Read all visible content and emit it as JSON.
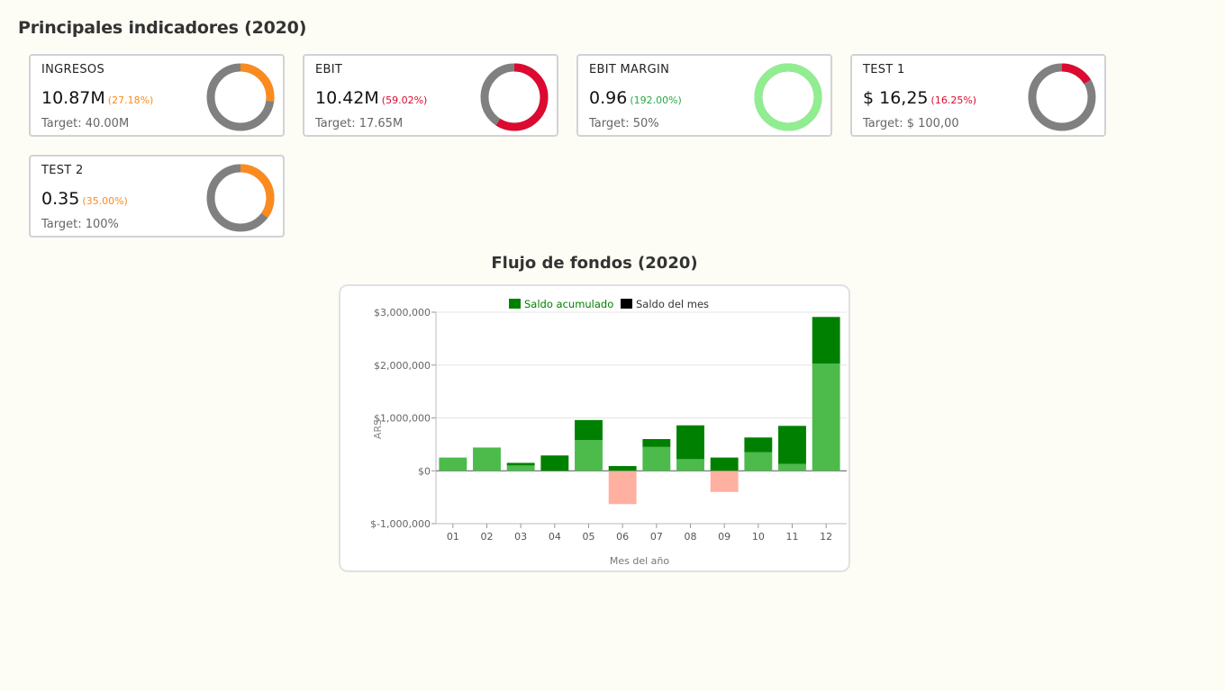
{
  "page": {
    "title": "Principales indicadores (2020)"
  },
  "kpis": [
    {
      "name": "INGRESOS",
      "value": "10.87M",
      "pct": "(27.18%)",
      "target": "Target: 40.00M",
      "fraction": 0.2718,
      "color": "#fb8b1e"
    },
    {
      "name": "EBIT",
      "value": "10.42M",
      "pct": "(59.02%)",
      "target": "Target: 17.65M",
      "fraction": 0.5902,
      "color": "#dc0a30"
    },
    {
      "name": "EBIT MARGIN",
      "value": "0.96",
      "pct": "(192.00%)",
      "target": "Target: 50%",
      "fraction": 1.0,
      "color": "#90ee90",
      "pct_color": "#2aa84a"
    },
    {
      "name": "TEST 1",
      "value": "$ 16,25",
      "pct": "(16.25%)",
      "target": "Target: $ 100,00",
      "fraction": 0.1625,
      "color": "#dc0a30"
    },
    {
      "name": "TEST 2",
      "value": "0.35",
      "pct": "(35.00%)",
      "target": "Target: 100%",
      "fraction": 0.35,
      "color": "#fb8b1e"
    }
  ],
  "colors": {
    "track": "#808080",
    "accumulated": "#4cbb4c",
    "month": "#008000",
    "negative": "#ffb0a0",
    "legend_accumulated": "#008000",
    "legend_month": "#000000"
  },
  "chart_data": {
    "type": "bar",
    "title": "Flujo de fondos (2020)",
    "xlabel": "Mes del año",
    "ylabel": "ARS",
    "categories": [
      "01",
      "02",
      "03",
      "04",
      "05",
      "06",
      "07",
      "08",
      "09",
      "10",
      "11",
      "12"
    ],
    "series": [
      {
        "name": "Saldo acumulado",
        "values": [
          250000,
          440000,
          100000,
          0,
          580000,
          -630000,
          450000,
          220000,
          -400000,
          350000,
          130000,
          2030000
        ]
      },
      {
        "name": "Saldo del mes",
        "values": [
          0,
          0,
          50000,
          290000,
          380000,
          90000,
          150000,
          640000,
          250000,
          280000,
          720000,
          880000
        ]
      }
    ],
    "ylim": [
      -1000000,
      3000000
    ],
    "yticks": [
      3000000,
      2000000,
      1000000,
      0,
      -1000000
    ],
    "ytick_labels": [
      "$3,000,000",
      "$2,000,000",
      "$1,000,000",
      "$0",
      "$-1,000,000"
    ],
    "legend_position": "top",
    "grid": true
  }
}
